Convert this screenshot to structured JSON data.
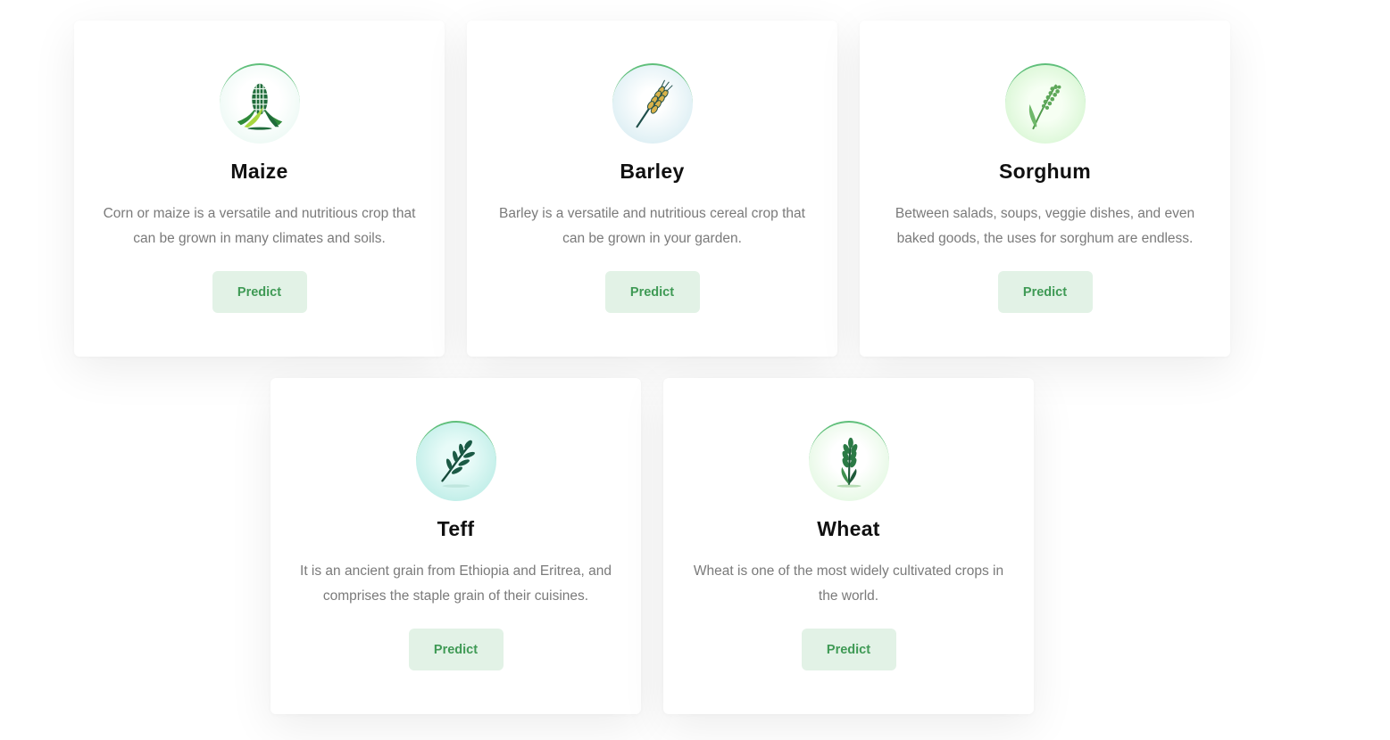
{
  "crops": [
    {
      "name": "Maize",
      "description": "Corn or maize is a versatile and nutritious crop that can be grown in many climates and soils.",
      "button_label": "Predict",
      "icon": "corn-icon"
    },
    {
      "name": "Barley",
      "description": "Barley is a versatile and nutritious cereal crop that can be grown in your garden.",
      "button_label": "Predict",
      "icon": "barley-icon"
    },
    {
      "name": "Sorghum",
      "description": "Between salads, soups, veggie dishes, and even baked goods, the uses for sorghum are endless.",
      "button_label": "Predict",
      "icon": "sorghum-icon"
    },
    {
      "name": "Teff",
      "description": "It is an ancient grain from Ethiopia and Eritrea, and comprises the staple grain of their cuisines.",
      "button_label": "Predict",
      "icon": "teff-icon"
    },
    {
      "name": "Wheat",
      "description": "Wheat is one of the most widely cultivated crops in the world.",
      "button_label": "Predict",
      "icon": "wheat-icon"
    }
  ],
  "colors": {
    "button_bg": "#e2f2e6",
    "button_text": "#3f9a55",
    "title": "#101010",
    "description": "#7a7a7a",
    "icon_ring": "#5fbf7a"
  }
}
